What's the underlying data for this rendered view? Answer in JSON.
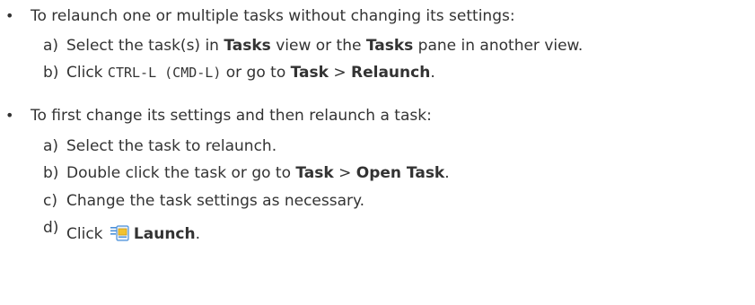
{
  "bullet1": {
    "symbol": "•",
    "intro": "To relaunch one or multiple tasks without changing its settings:",
    "step_a": {
      "marker": "a)",
      "t1": "Select the task(s) in ",
      "b1": "Tasks",
      "t2": " view or the ",
      "b2": "Tasks",
      "t3": " pane in another view."
    },
    "step_b": {
      "marker": "b)",
      "t1": "Click ",
      "code": "CTRL-L (CMD-L)",
      "t2": " or go to ",
      "b1": "Task",
      "sep": " > ",
      "b2": "Relaunch",
      "end": "."
    }
  },
  "bullet2": {
    "symbol": "•",
    "intro": "To first change its settings and then relaunch a task:",
    "step_a": {
      "marker": "a)",
      "text": "Select the task to relaunch."
    },
    "step_b": {
      "marker": "b)",
      "t1": "Double click the task or go to ",
      "b1": "Task",
      "sep": " > ",
      "b2": "Open Task",
      "end": "."
    },
    "step_c": {
      "marker": "c)",
      "text": "Change the task settings as necessary."
    },
    "step_d": {
      "marker": "d)",
      "t1": "Click ",
      "icon": "launch-icon",
      "b1": "Launch",
      "end": "."
    }
  },
  "colors": {
    "text": "#333333",
    "background": "#ffffff",
    "icon_blue": "#4a90d9",
    "icon_yellow": "#f2c230"
  }
}
